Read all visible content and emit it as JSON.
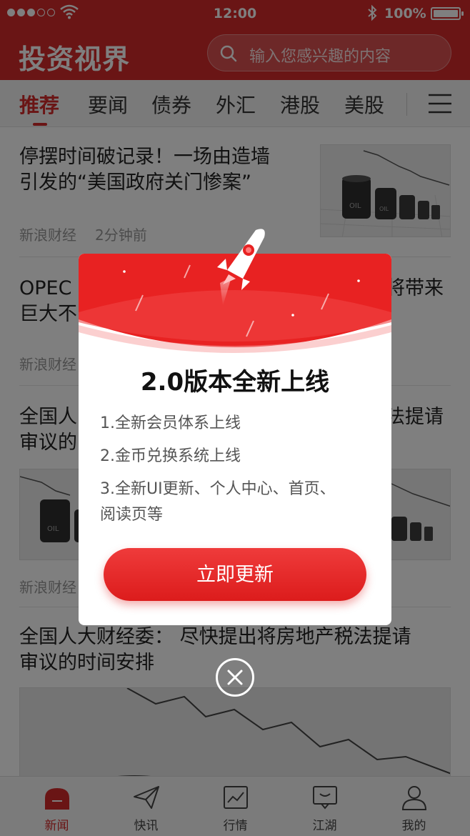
{
  "status_bar": {
    "time": "12:00",
    "battery": "100%"
  },
  "header": {
    "logo": "投资视界",
    "search_placeholder": "输入您感兴趣的内容"
  },
  "tabs": [
    {
      "label": "推荐",
      "active": true
    },
    {
      "label": "要闻"
    },
    {
      "label": "债券"
    },
    {
      "label": "外汇"
    },
    {
      "label": "港股"
    },
    {
      "label": "美股"
    }
  ],
  "articles": [
    {
      "title_line1": "停摆时间破记录！一场由造墙",
      "title_line2": "引发的“美国政府关门惨案”",
      "source": "新浪财经",
      "time": "2分钟前"
    },
    {
      "title_line1": "OPEC",
      "title_line1_end": "将带来",
      "title_line2": "巨大不",
      "source": "新浪财经"
    },
    {
      "title_line1": "全国人",
      "title_line1_end": "法提请",
      "title_line2": "审议的",
      "source": "新浪财经"
    },
    {
      "title_line1": "全国人大财经委： 尽快提出将房地产税法提请",
      "title_line2": "审议的时间安排"
    }
  ],
  "modal": {
    "title": "2.0版本全新上线",
    "features": [
      "1.全新会员体系上线",
      "2.金币兑换系统上线",
      "3.全新UI更新、个人中心、首页、",
      "阅读页等"
    ],
    "button": "立即更新"
  },
  "bottom_nav": [
    {
      "label": "新闻",
      "icon": "news-icon",
      "active": true
    },
    {
      "label": "快讯",
      "icon": "paper-plane-icon"
    },
    {
      "label": "行情",
      "icon": "chart-icon"
    },
    {
      "label": "江湖",
      "icon": "chat-icon"
    },
    {
      "label": "我的",
      "icon": "user-icon"
    }
  ],
  "colors": {
    "brand": "#d42a2a",
    "accent": "#e82222"
  }
}
